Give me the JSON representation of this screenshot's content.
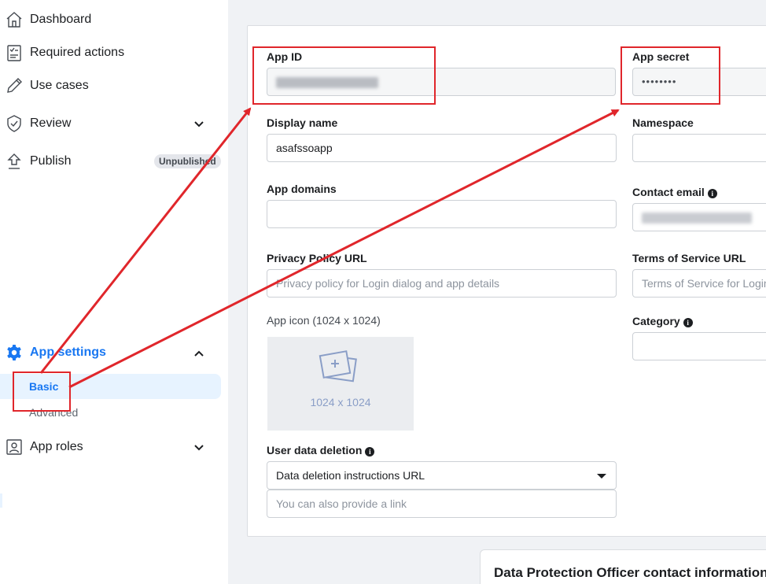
{
  "sidebar": {
    "dashboard": "Dashboard",
    "required_actions": "Required actions",
    "use_cases": "Use cases",
    "review": "Review",
    "publish": "Publish",
    "publish_badge": "Unpublished",
    "app_settings": "App settings",
    "basic": "Basic",
    "advanced": "Advanced",
    "app_roles": "App roles"
  },
  "form": {
    "app_id_label": "App ID",
    "app_id_value": "",
    "app_secret_label": "App secret",
    "app_secret_value": "••••••••",
    "display_name_label": "Display name",
    "display_name_value": "asafssoapp",
    "namespace_label": "Namespace",
    "app_domains_label": "App domains",
    "contact_email_label": "Contact email",
    "privacy_policy_label": "Privacy Policy URL",
    "privacy_policy_placeholder": "Privacy policy for Login dialog and app details",
    "terms_label": "Terms of Service URL",
    "terms_placeholder": "Terms of Service for Login",
    "app_icon_label": "App icon (1024 x 1024)",
    "app_icon_placeholder": "1024 x 1024",
    "category_label": "Category",
    "user_data_deletion_label": "User data deletion",
    "deletion_select_value": "Data deletion instructions URL",
    "deletion_link_placeholder": "You can also provide a link"
  },
  "dpo_section": {
    "title": "Data Protection Officer contact information"
  },
  "colors": {
    "accent": "#1877f2",
    "annotation_red": "#e0262b",
    "page_bg": "#f0f2f5"
  },
  "icons": [
    "home-icon",
    "checklist-icon",
    "pencil-icon",
    "shield-check-icon",
    "upload-icon",
    "gear-icon",
    "id-badge-icon",
    "chevron-down-icon",
    "chevron-up-icon",
    "info-icon",
    "image-placeholder-icon",
    "dropdown-caret-icon"
  ]
}
